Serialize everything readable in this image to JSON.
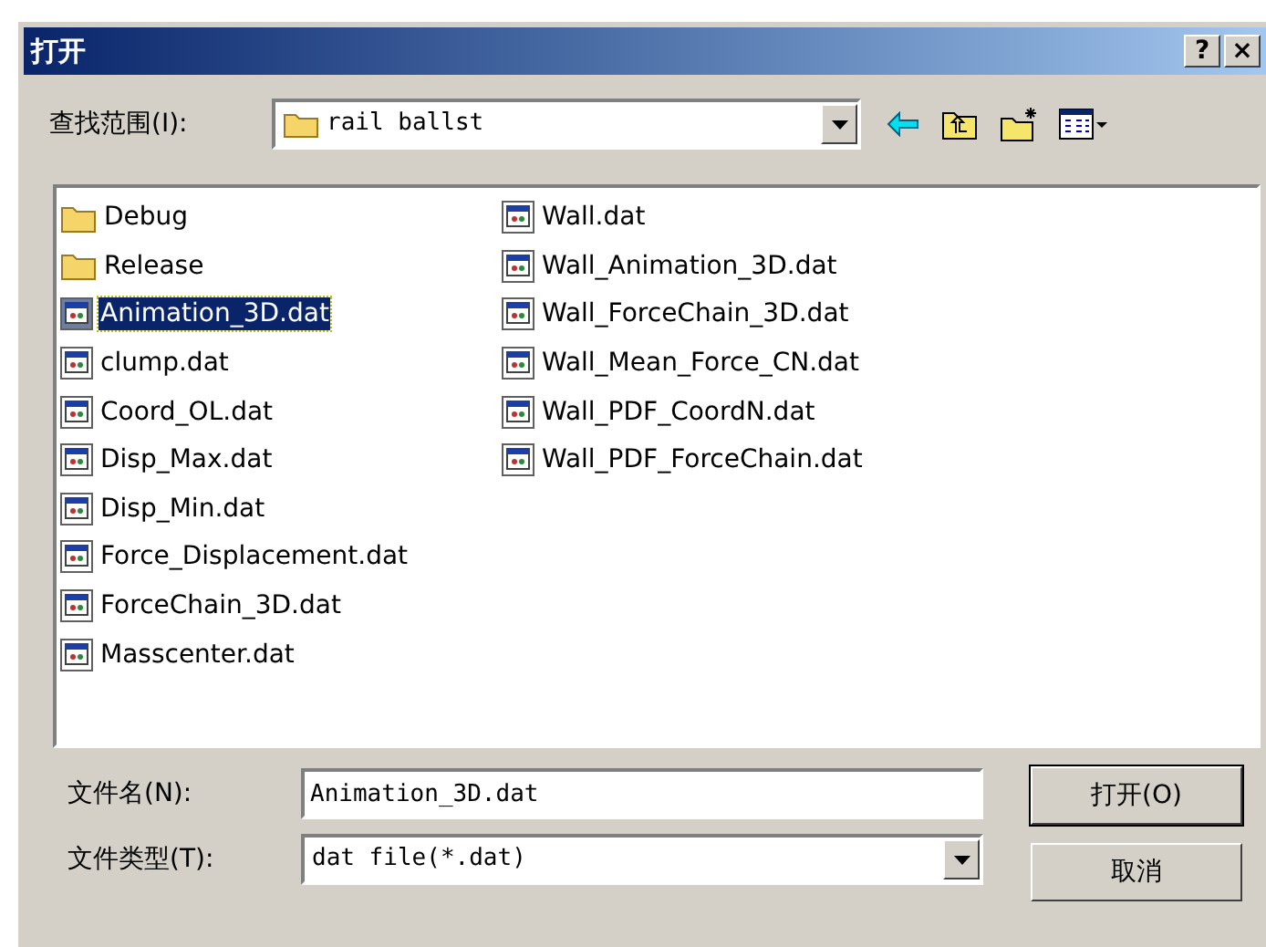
{
  "window": {
    "title": "打开",
    "title_buttons": [
      "?",
      "×"
    ]
  },
  "look_in": {
    "label": "查找范围(I):",
    "value": "rail ballst"
  },
  "files": [
    {
      "name": "Debug",
      "kind": "folder",
      "selected": false
    },
    {
      "name": "Release",
      "kind": "folder",
      "selected": false
    },
    {
      "name": "Animation_3D.dat",
      "kind": "file",
      "selected": true
    },
    {
      "name": "clump.dat",
      "kind": "file",
      "selected": false
    },
    {
      "name": "Coord_OL.dat",
      "kind": "file",
      "selected": false
    },
    {
      "name": "Disp_Max.dat",
      "kind": "file",
      "selected": false
    },
    {
      "name": "Disp_Min.dat",
      "kind": "file",
      "selected": false
    },
    {
      "name": "Force_Displacement.dat",
      "kind": "file",
      "selected": false
    },
    {
      "name": "ForceChain_3D.dat",
      "kind": "file",
      "selected": false
    },
    {
      "name": "Masscenter.dat",
      "kind": "file",
      "selected": false
    },
    {
      "name": "Wall.dat",
      "kind": "file",
      "selected": false
    },
    {
      "name": "Wall_Animation_3D.dat",
      "kind": "file",
      "selected": false
    },
    {
      "name": "Wall_ForceChain_3D.dat",
      "kind": "file",
      "selected": false
    },
    {
      "name": "Wall_Mean_Force_CN.dat",
      "kind": "file",
      "selected": false
    },
    {
      "name": "Wall_PDF_CoordN.dat",
      "kind": "file",
      "selected": false
    },
    {
      "name": "Wall_PDF_ForceChain.dat",
      "kind": "file",
      "selected": false
    }
  ],
  "file_name": {
    "label": "文件名(N):",
    "value": "Animation_3D.dat"
  },
  "file_type": {
    "label": "文件类型(T):",
    "value": "dat file(*.dat)"
  },
  "buttons": [
    "打开(O)",
    "取消"
  ]
}
